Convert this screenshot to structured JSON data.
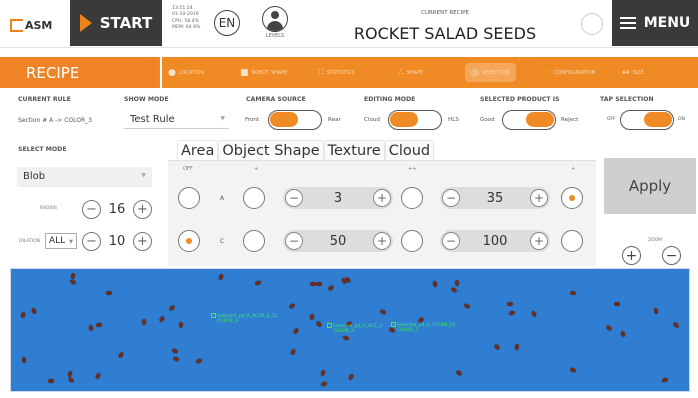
{
  "header": {
    "logo_text": "ASM",
    "start_label": "START",
    "status_lines": [
      "13:51:24",
      "01-10-2019",
      "CPU: 58.4%",
      "MEM: 64.9%"
    ],
    "language": "EN",
    "levels_label": "LEVELS",
    "current_recipe_caption": "CURRENT RECIPE",
    "current_recipe_name": "ROCKET SALAD SEEDS",
    "menu_label": "MENU"
  },
  "toolbar": {
    "section_title": "RECIPE",
    "tools": [
      {
        "icon": "pin-icon",
        "label": "LOCATION"
      },
      {
        "icon": "camera-icon",
        "label": "ROBOT SHAPE"
      },
      {
        "icon": "grid-icon",
        "label": "STATISTICS"
      },
      {
        "icon": "shape-icon",
        "label": "SHAPE"
      },
      {
        "icon": "target-icon",
        "label": "SELECTION"
      },
      {
        "icon": "dots-icon",
        "label": "CONFIGURATION"
      },
      {
        "icon": "ruler-icon",
        "label": "SIZE"
      }
    ]
  },
  "controls": {
    "current_rule_label": "CURRENT RULE",
    "current_rule_value": "Section # A -> COLOR_3",
    "show_mode_label": "SHOW MODE",
    "show_mode_value": "Test Rule",
    "camera_source_label": "CAMERA SOURCE",
    "camera_source": {
      "left": "Front",
      "right": "Rear",
      "selected": "left"
    },
    "editing_mode_label": "EDITING MODE",
    "editing_mode": {
      "left": "Cloud",
      "right": "HLS",
      "selected": "left"
    },
    "selected_product_label": "SELECTED PRODUCT IS",
    "selected_product": {
      "left": "Good",
      "right": "Reject",
      "selected": "right"
    },
    "tap_selection_label": "TAP SELECTION",
    "tap_selection": {
      "left": "OFF",
      "right": "ON",
      "selected": "right"
    }
  },
  "left_panel": {
    "select_mode_label": "SELECT MODE",
    "select_mode_value": "Blob",
    "radius_label": "RADIUS",
    "radius_value": "16",
    "dilation_label": "DILATION",
    "dilation_select": "ALL",
    "dilation_value": "10"
  },
  "tabs": [
    "Area",
    "Object Shape",
    "Texture",
    "Cloud"
  ],
  "active_tab": "Area",
  "area_panel": {
    "col_labels": [
      "OFF",
      "+",
      "++",
      "+"
    ],
    "rows": [
      {
        "letter": "A",
        "value1": "3",
        "value2": "35"
      },
      {
        "letter": "C",
        "value1": "50",
        "value2": "100"
      }
    ]
  },
  "apply_label": "Apply",
  "zoom_label": "ZOOM",
  "camera_view": {
    "detections": [
      {
        "line1": "Selected_pd_A_ACAR_2_11",
        "line2": "COLOR_3"
      },
      {
        "line1": "Selected_pd_A_AC1_3",
        "line2": "COLOR_3"
      },
      {
        "line1": "Selected_pd_A_1PCAN_15",
        "line2": "COLOR_3"
      }
    ]
  }
}
